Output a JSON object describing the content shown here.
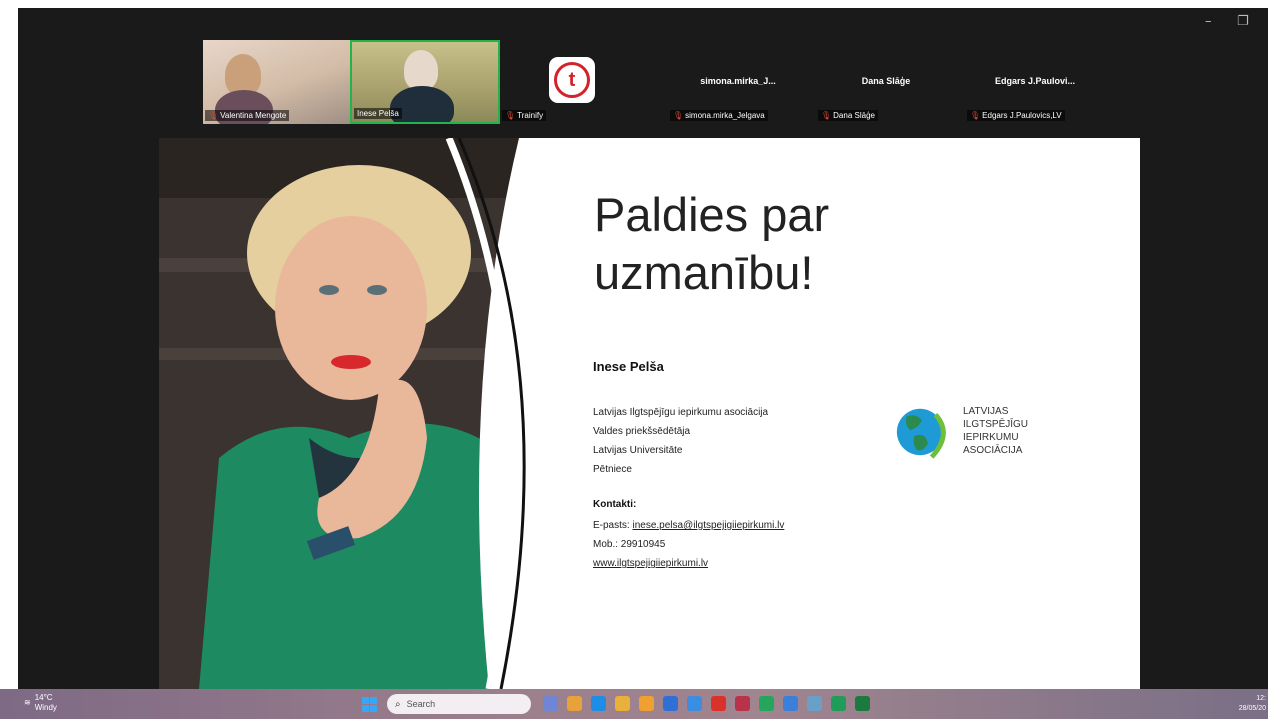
{
  "window_controls": {
    "minimize": "–",
    "restore": "❐"
  },
  "participants": [
    {
      "name": "Valentina Mengote",
      "type": "video"
    },
    {
      "name": "Inese Pelša",
      "type": "video",
      "active": true
    },
    {
      "name": "Trainify",
      "type": "logo"
    },
    {
      "name": "simona.mirka_Jelgava",
      "display": "simona.mirka_J...",
      "type": "name"
    },
    {
      "name": "Dana Slāģe",
      "display": "Dana Slāģe",
      "type": "name"
    },
    {
      "name": "Edgars J.Paulovics,LV",
      "display": "Edgars  J.Paulovi...",
      "type": "name"
    }
  ],
  "slide": {
    "title_line1": "Paldies par",
    "title_line2": "uzmanību!",
    "presenter_name": "Inese Pelša",
    "info": [
      "Latvijas Ilgtspējīgu iepirkumu asociācija",
      "Valdes priekšsēdētāja",
      "Latvijas Universitāte",
      "Pētniece"
    ],
    "contacts_heading": "Kontakti:",
    "email_label": "E-pasts: ",
    "email": "inese.pelsa@ilgtspejigiiepirkumi.lv",
    "phone": "Mob.: 29910945",
    "website": "www.ilgtspejigiiepirkumi.lv",
    "logo_lines": [
      "LATVIJAS",
      "ILGTSPĒJĪGU",
      "IEPIRKUMU",
      "ASOCIĀCIJA"
    ]
  },
  "taskbar": {
    "temperature": "14°C",
    "weather": "Windy",
    "search_placeholder": "Search",
    "time": "12:",
    "date": "28/05/20",
    "app_colors": [
      "#6f86d6",
      "#e8a23a",
      "#1f8ce6",
      "#e8b23a",
      "#f0a030",
      "#2f6fd6",
      "#3b8de0",
      "#d8322a",
      "#b8324a",
      "#25a65b",
      "#3a7fd8",
      "#6aa0c8",
      "#1f9d58",
      "#1d7a3e"
    ]
  }
}
